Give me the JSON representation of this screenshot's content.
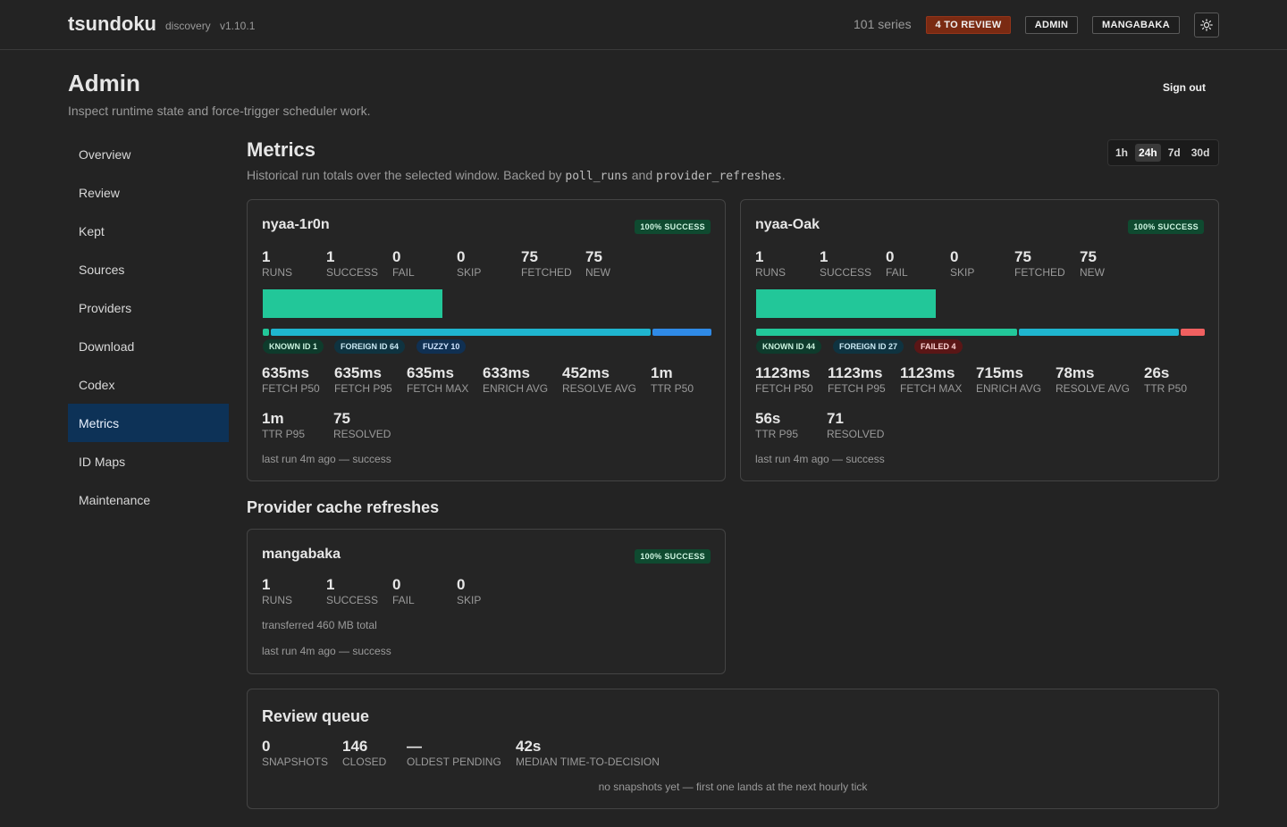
{
  "app": {
    "brand": "tsundoku",
    "subtitle": "discovery",
    "version": "v1.10.1",
    "series_count": "101 series",
    "review_button": "4 TO REVIEW",
    "admin_button": "ADMIN",
    "mangabaka_button": "MANGABAKA",
    "theme_icon": "sun-icon"
  },
  "page": {
    "title": "Admin",
    "subtitle": "Inspect runtime state and force-trigger scheduler work.",
    "sign_out": "Sign out"
  },
  "sidebar": {
    "items": [
      {
        "label": "Overview"
      },
      {
        "label": "Review"
      },
      {
        "label": "Kept"
      },
      {
        "label": "Sources"
      },
      {
        "label": "Providers"
      },
      {
        "label": "Download"
      },
      {
        "label": "Codex"
      },
      {
        "label": "Metrics"
      },
      {
        "label": "ID Maps"
      },
      {
        "label": "Maintenance"
      }
    ],
    "active": "Metrics"
  },
  "metrics": {
    "title": "Metrics",
    "desc_prefix": "Historical run totals over the selected window. Backed by",
    "desc_code1": "poll_runs",
    "desc_and": "and",
    "desc_code2": "provider_refreshes",
    "desc_suffix": ".",
    "ranges": [
      "1h",
      "24h",
      "7d",
      "30d"
    ],
    "selected_range": "24h"
  },
  "sources": [
    {
      "name": "nyaa-1r0n",
      "badge": "100% SUCCESS",
      "runs": "1",
      "runs_label": "RUNS",
      "success": "1",
      "success_label": "SUCCESS",
      "fail": "0",
      "fail_label": "FAIL",
      "skip": "0",
      "skip_label": "SKIP",
      "fetched": "75",
      "fetched_label": "FETCHED",
      "new": "75",
      "new_label": "NEW",
      "new_ratio": 0.4,
      "segments": [
        {
          "key": "known",
          "count": 1,
          "color": "#22c799"
        },
        {
          "key": "foreign",
          "count": 64,
          "color": "#1fb5cf"
        },
        {
          "key": "fuzzy",
          "count": 10,
          "color": "#2f8ae6"
        }
      ],
      "chips": [
        "KNOWN ID 1",
        "FOREIGN ID 64",
        "FUZZY 10"
      ],
      "timings": [
        {
          "v": "635ms",
          "l": "FETCH P50"
        },
        {
          "v": "635ms",
          "l": "FETCH P95"
        },
        {
          "v": "635ms",
          "l": "FETCH MAX"
        },
        {
          "v": "633ms",
          "l": "ENRICH AVG"
        },
        {
          "v": "452ms",
          "l": "RESOLVE AVG"
        },
        {
          "v": "1m",
          "l": "TTR P50"
        }
      ],
      "timings2": [
        {
          "v": "1m",
          "l": "TTR P95"
        },
        {
          "v": "75",
          "l": "RESOLVED"
        }
      ],
      "last_run": "last run 4m ago — success"
    },
    {
      "name": "nyaa-Oak",
      "badge": "100% SUCCESS",
      "runs": "1",
      "runs_label": "RUNS",
      "success": "1",
      "success_label": "SUCCESS",
      "fail": "0",
      "fail_label": "FAIL",
      "skip": "0",
      "skip_label": "SKIP",
      "fetched": "75",
      "fetched_label": "FETCHED",
      "new": "75",
      "new_label": "NEW",
      "new_ratio": 0.4,
      "segments": [
        {
          "key": "known",
          "count": 44,
          "color": "#22c799"
        },
        {
          "key": "foreign",
          "count": 27,
          "color": "#1fb5cf"
        },
        {
          "key": "failed",
          "count": 4,
          "color": "#f06060"
        }
      ],
      "chips": [
        "KNOWN ID 44",
        "FOREIGN ID 27",
        "FAILED 4"
      ],
      "timings": [
        {
          "v": "1123ms",
          "l": "FETCH P50"
        },
        {
          "v": "1123ms",
          "l": "FETCH P95"
        },
        {
          "v": "1123ms",
          "l": "FETCH MAX"
        },
        {
          "v": "715ms",
          "l": "ENRICH AVG"
        },
        {
          "v": "78ms",
          "l": "RESOLVE AVG"
        },
        {
          "v": "26s",
          "l": "TTR P50"
        }
      ],
      "timings2": [
        {
          "v": "56s",
          "l": "TTR P95"
        },
        {
          "v": "71",
          "l": "RESOLVED"
        }
      ],
      "last_run": "last run 4m ago — success"
    }
  ],
  "provider_refreshes": {
    "title": "Provider cache refreshes",
    "card": {
      "name": "mangabaka",
      "badge": "100% SUCCESS",
      "runs": "1",
      "runs_label": "RUNS",
      "success": "1",
      "success_label": "SUCCESS",
      "fail": "0",
      "fail_label": "FAIL",
      "skip": "0",
      "skip_label": "SKIP",
      "transferred": "transferred 460 MB total",
      "last_run": "last run 4m ago — success"
    }
  },
  "review_queue": {
    "title": "Review queue",
    "stats": [
      {
        "v": "0",
        "l": "SNAPSHOTS"
      },
      {
        "v": "146",
        "l": "CLOSED"
      },
      {
        "v": "—",
        "l": "OLDEST PENDING"
      },
      {
        "v": "42s",
        "l": "MEDIAN TIME-TO-DECISION"
      }
    ],
    "note": "no snapshots yet — first one lands at the next hourly tick"
  }
}
